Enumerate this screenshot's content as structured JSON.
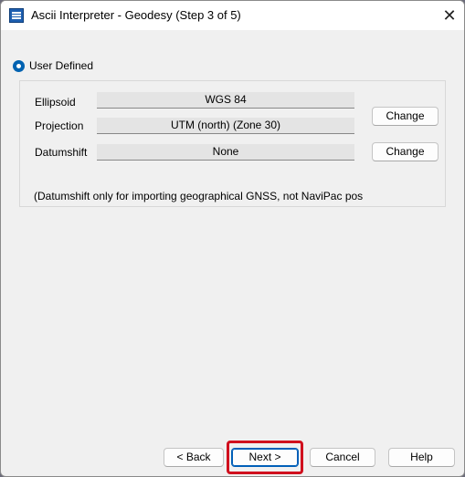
{
  "window": {
    "title": "Ascii Interpreter - Geodesy (Step 3 of 5)",
    "app_icon": "document-grid-icon",
    "close_icon": "close-icon",
    "close_glyph": "✕"
  },
  "mode": {
    "label": "User Defined",
    "selected": true
  },
  "fields": {
    "ellipsoid": {
      "label": "Ellipsoid",
      "value": "WGS 84"
    },
    "projection": {
      "label": "Projection",
      "value": "UTM (north)  (Zone 30)",
      "change_label": "Change"
    },
    "datumshift": {
      "label": "Datumshift",
      "value": "None",
      "change_label": "Change"
    }
  },
  "note": "(Datumshift only for importing geographical GNSS, not NaviPac pos",
  "footer": {
    "back_label": "< Back",
    "next_label": "Next >",
    "cancel_label": "Cancel",
    "help_label": "Help"
  },
  "colors": {
    "accent": "#0062b1",
    "highlight": "#d0101e"
  }
}
